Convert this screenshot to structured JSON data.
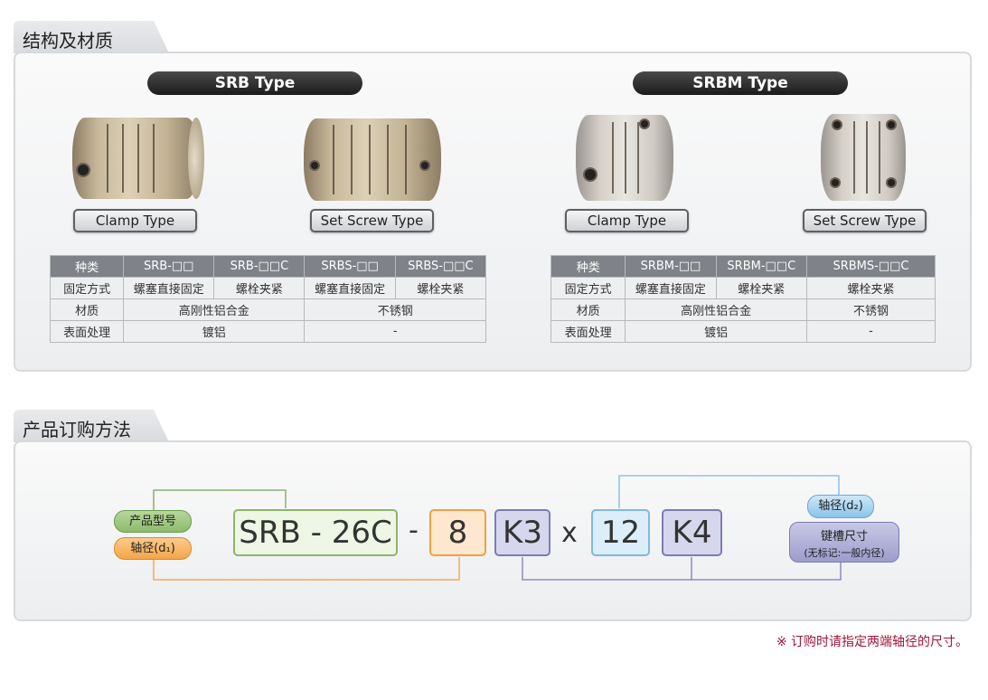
{
  "section1": {
    "title": "结构及材质"
  },
  "section2": {
    "title": "产品订购方法"
  },
  "srb": {
    "title": "SRB Type",
    "clamp_label": "Clamp Type",
    "setscrew_label": "Set Screw Type",
    "table": {
      "head": [
        "种类",
        "SRB-□□",
        "SRB-□□C",
        "SRBS-□□",
        "SRBS-□□C"
      ],
      "row1": [
        "固定方式",
        "螺塞直接固定",
        "螺栓夹紧",
        "螺塞直接固定",
        "螺栓夹紧"
      ],
      "row2": [
        "材质",
        "高刚性铝合金",
        "不锈钢"
      ],
      "row3": [
        "表面处理",
        "镀铝",
        "-"
      ]
    }
  },
  "srbm": {
    "title": "SRBM Type",
    "clamp_label": "Clamp Type",
    "setscrew_label": "Set Screw Type",
    "table": {
      "head": [
        "种类",
        "SRBM-□□",
        "SRBM-□□C",
        "SRBMS-□□C"
      ],
      "row1": [
        "固定方式",
        "螺塞直接固定",
        "螺栓夹紧",
        "螺栓夹紧"
      ],
      "row2": [
        "材质",
        "高刚性铝合金",
        "不锈钢"
      ],
      "row3": [
        "表面处理",
        "镀铝",
        "-"
      ]
    }
  },
  "order": {
    "model_label": "产品型号",
    "bore1_label": "轴径(d₁)",
    "bore2_label": "轴径(d₂)",
    "keyway_label": "键槽尺寸",
    "keyway_sub": "(无标记:一般内径)",
    "code_model": "SRB - 26C",
    "dash": "-",
    "code_d1": "8",
    "code_k3": "K3",
    "times": "x",
    "code_d2": "12",
    "code_k4": "K4"
  },
  "note": "※  订购时请指定两端轴径的尺寸。",
  "colors": {
    "green": "#7ba35a",
    "orange": "#f0a044",
    "purple": "#7d7cb4",
    "blue": "#7fb9de"
  }
}
